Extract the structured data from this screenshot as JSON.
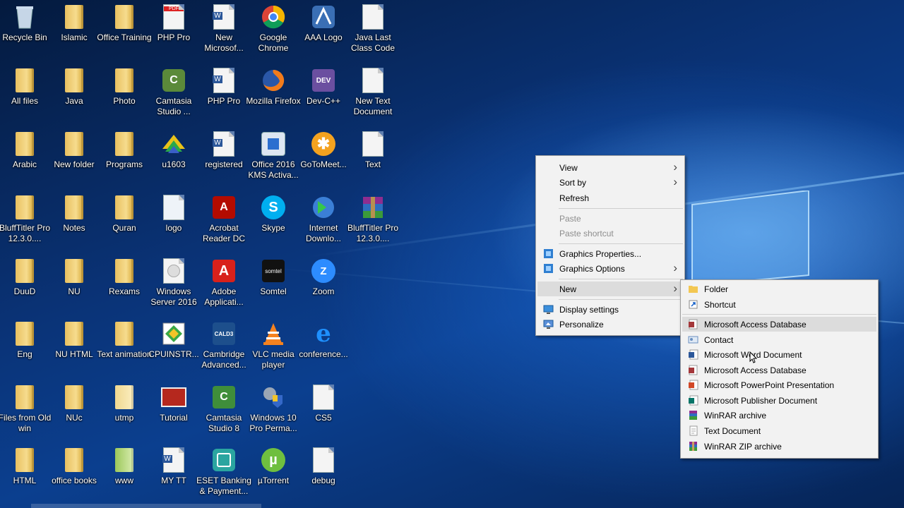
{
  "desktop": {
    "icons": [
      {
        "label": "Recycle Bin"
      },
      {
        "label": "Islamic"
      },
      {
        "label": "Office Training"
      },
      {
        "label": "PHP Pro"
      },
      {
        "label": "New Microsof..."
      },
      {
        "label": "Google Chrome"
      },
      {
        "label": "AAA Logo"
      },
      {
        "label": "Java Last Class Code"
      },
      {
        "label": "All  files"
      },
      {
        "label": "Java"
      },
      {
        "label": "Photo"
      },
      {
        "label": "Camtasia Studio ..."
      },
      {
        "label": "PHP Pro"
      },
      {
        "label": "Mozilla Firefox"
      },
      {
        "label": "Dev-C++"
      },
      {
        "label": "New Text Document"
      },
      {
        "label": "Arabic"
      },
      {
        "label": "New folder"
      },
      {
        "label": "Programs"
      },
      {
        "label": "u1603"
      },
      {
        "label": "registered"
      },
      {
        "label": "Office 2016 KMS Activa..."
      },
      {
        "label": "GoToMeet..."
      },
      {
        "label": "Text"
      },
      {
        "label": "BluffTitler Pro 12.3.0...."
      },
      {
        "label": "Notes"
      },
      {
        "label": "Quran"
      },
      {
        "label": "logo"
      },
      {
        "label": "Acrobat Reader DC"
      },
      {
        "label": "Skype"
      },
      {
        "label": "Internet Downlo..."
      },
      {
        "label": "BluffTitler Pro 12.3.0...."
      },
      {
        "label": "DuuD"
      },
      {
        "label": "NU"
      },
      {
        "label": "Rexams"
      },
      {
        "label": "Windows Server 2016"
      },
      {
        "label": "Adobe Applicati..."
      },
      {
        "label": "Somtel"
      },
      {
        "label": "Zoom"
      },
      {
        "label": "Eng"
      },
      {
        "label": "NU HTML"
      },
      {
        "label": "Text animation"
      },
      {
        "label": "CPUINSTR..."
      },
      {
        "label": "Cambridge Advanced..."
      },
      {
        "label": "VLC media player"
      },
      {
        "label": "conference..."
      },
      {
        "label": "Files from Old win"
      },
      {
        "label": "NUc"
      },
      {
        "label": "utmp"
      },
      {
        "label": "Tutorial"
      },
      {
        "label": "Camtasia Studio 8"
      },
      {
        "label": "Windows 10 Pro Perma..."
      },
      {
        "label": "CS5"
      },
      {
        "label": "HTML"
      },
      {
        "label": "office books"
      },
      {
        "label": "www"
      },
      {
        "label": "MY TT"
      },
      {
        "label": "ESET Banking & Payment..."
      },
      {
        "label": "µTorrent"
      },
      {
        "label": "debug"
      }
    ],
    "icon_glyphs": {
      "pdf": "PDF",
      "word": "W",
      "dev": "DEV",
      "acrobat": "A",
      "skype": "S",
      "adobe": "A",
      "zoom": "Z",
      "ie": "e",
      "cald": "CALD3",
      "utorrent": "µ",
      "camtasia": "C",
      "gotomeeting": "✱",
      "somtel": "somtel"
    }
  },
  "context_menu": {
    "items": [
      {
        "label": "View"
      },
      {
        "label": "Sort by"
      },
      {
        "label": "Refresh"
      },
      {
        "label": "Paste"
      },
      {
        "label": "Paste shortcut"
      },
      {
        "label": "Graphics Properties..."
      },
      {
        "label": "Graphics Options"
      },
      {
        "label": "New"
      },
      {
        "label": "Display settings"
      },
      {
        "label": "Personalize"
      }
    ]
  },
  "new_submenu": {
    "items": [
      {
        "label": "Folder"
      },
      {
        "label": "Shortcut"
      },
      {
        "label": "Microsoft Access Database"
      },
      {
        "label": "Contact"
      },
      {
        "label": "Microsoft Word Document"
      },
      {
        "label": "Microsoft Access Database"
      },
      {
        "label": "Microsoft PowerPoint Presentation"
      },
      {
        "label": "Microsoft Publisher Document"
      },
      {
        "label": "WinRAR archive"
      },
      {
        "label": "Text Document"
      },
      {
        "label": "WinRAR ZIP archive"
      }
    ]
  },
  "colors": {
    "menu_bg": "#f2f2f2",
    "menu_highlight": "#dcdcdc",
    "desktop_blue": "#0b3f8f"
  }
}
